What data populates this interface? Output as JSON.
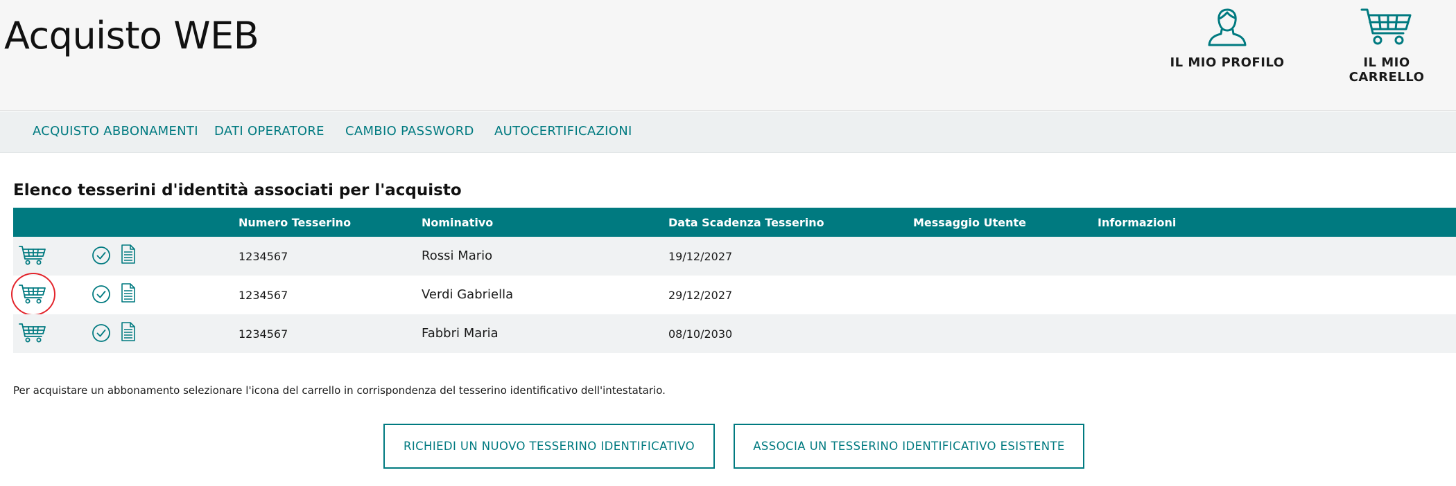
{
  "header": {
    "title": "Acquisto WEB",
    "profile_label": "IL MIO PROFILO",
    "cart_label": "IL MIO CARRELLO",
    "profile_icon": "user-icon",
    "cart_icon": "cart-icon"
  },
  "nav": {
    "items": [
      {
        "label": "ACQUISTO ABBONAMENTI"
      },
      {
        "label": "DATI OPERATORE"
      },
      {
        "label": "CAMBIO PASSWORD"
      },
      {
        "label": "AUTOCERTIFICAZIONI"
      }
    ]
  },
  "section": {
    "title": "Elenco tesserini d'identità associati per l'acquisto"
  },
  "table": {
    "columns": [
      "Numero Tesserino",
      "Nominativo",
      "Data Scadenza Tesserino",
      "Messaggio Utente",
      "Informazioni"
    ],
    "rows": [
      {
        "numero": "1234567",
        "nominativo": "Rossi Mario",
        "scadenza": "19/12/2027",
        "messaggio": "",
        "informazioni": ""
      },
      {
        "numero": "1234567",
        "nominativo": "Verdi Gabriella",
        "scadenza": "29/12/2027",
        "messaggio": "",
        "informazioni": ""
      },
      {
        "numero": "1234567",
        "nominativo": "Fabbri Maria",
        "scadenza": "08/10/2030",
        "messaggio": "",
        "informazioni": ""
      }
    ]
  },
  "hint": "Per acquistare un abbonamento selezionare l'icona del carrello in corrispondenza del tesserino identificativo dell'intestatario.",
  "buttons": {
    "new_card": "RICHIEDI UN NUOVO TESSERINO IDENTIFICATIVO",
    "associate_card": "ASSOCIA UN TESSERINO IDENTIFICATIVO ESISTENTE"
  },
  "colors": {
    "accent": "#007a80",
    "highlight": "#e3242b",
    "header_bg": "#f6f6f6",
    "nav_bg": "#edf0f1"
  }
}
